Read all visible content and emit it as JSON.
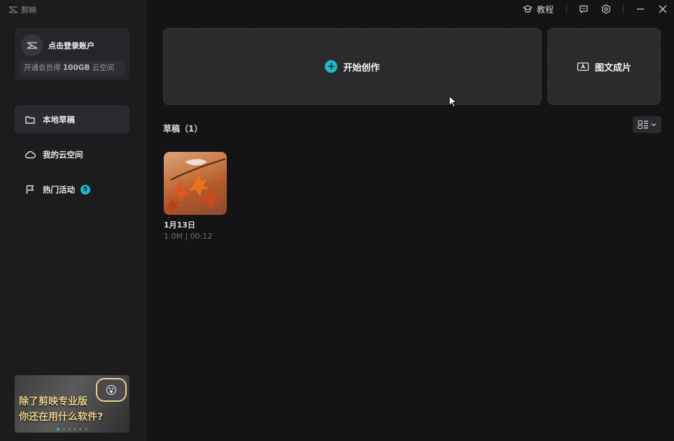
{
  "app": {
    "logo_text": "剪映"
  },
  "account": {
    "login_label": "点击登录账户",
    "vip_promo_prefix": "开通会员得 ",
    "vip_promo_highlight": "100GB",
    "vip_promo_suffix": " 云空间"
  },
  "sidebar": {
    "items": [
      {
        "label": "本地草稿",
        "icon": "folder-icon",
        "active": true
      },
      {
        "label": "我的云空间",
        "icon": "cloud-icon",
        "active": false
      },
      {
        "label": "热门活动",
        "icon": "flag-icon",
        "active": false,
        "badge": "5"
      }
    ]
  },
  "banner": {
    "line1": "除了剪映专业版",
    "line2": "你还在用什么软件?",
    "dots": 6,
    "active_dot": 0
  },
  "topbar": {
    "tutorial_label": "教程"
  },
  "main": {
    "create_label": "开始创作",
    "text2video_label": "图文成片",
    "drafts_title": "草稿（1）"
  },
  "drafts": [
    {
      "name": "1月13日",
      "meta": "1.0M | 00:12"
    }
  ],
  "colors": {
    "accent": "#1fb8c9",
    "background": "#141416",
    "sidebar": "#1c1c1f",
    "card": "#2b2b2e"
  }
}
